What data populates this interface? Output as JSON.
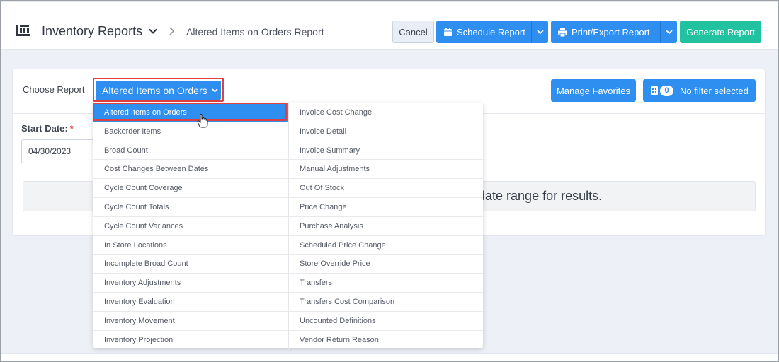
{
  "header": {
    "module_title": "Inventory Reports",
    "breadcrumb_current": "Altered Items on Orders Report",
    "cancel_label": "Cancel",
    "schedule_label": "Schedule Report",
    "print_label": "Print/Export Report",
    "generate_label": "Generate Report"
  },
  "controls": {
    "choose_label": "Choose Report",
    "selected_report": "Altered Items on Orders",
    "manage_favorites_label": "Manage Favorites",
    "filter_count": "0",
    "filter_label": "No filter selected"
  },
  "form": {
    "start_date_label": "Start Date:",
    "required_marker": "*",
    "start_date_value": "04/30/2023",
    "info_text": "e date range for results."
  },
  "dropdown": {
    "left_items": [
      "Altered Items on Orders",
      "Backorder Items",
      "Broad Count",
      "Cost Changes Between Dates",
      "Cycle Count Coverage",
      "Cycle Count Totals",
      "Cycle Count Variances",
      "In Store Locations",
      "Incomplete Broad Count",
      "Inventory Adjustments",
      "Inventory Evaluation",
      "Inventory Movement",
      "Inventory Projection"
    ],
    "right_items": [
      "Invoice Cost Change",
      "Invoice Detail",
      "Invoice Summary",
      "Manual Adjustments",
      "Out Of Stock",
      "Price Change",
      "Purchase Analysis",
      "Scheduled Price Change",
      "Store Override Price",
      "Transfers",
      "Transfers Cost Comparison",
      "Uncounted Definitions",
      "Vendor Return Reason"
    ]
  },
  "colors": {
    "primary": "#2e8ff0",
    "generate": "#20c2a0",
    "highlight": "#e0403f"
  },
  "icons": [
    "module-icon",
    "chevron-down-icon",
    "chevron-right-icon",
    "calendar-icon",
    "printer-icon",
    "filter-icon",
    "hand-cursor-icon"
  ]
}
